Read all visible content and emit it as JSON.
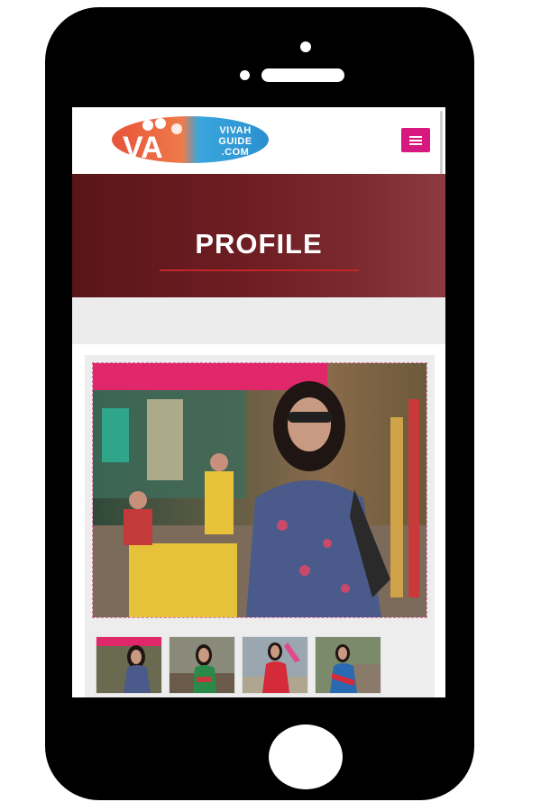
{
  "brand": {
    "line1": "VIVAH",
    "line2": "GUIDE",
    "line3": ".COM",
    "logo_letters": "VA",
    "colors": {
      "orange": "#e8543a",
      "blue": "#2aa8e0",
      "pink": "#d6187f"
    }
  },
  "header": {
    "menu_icon": "hamburger-icon"
  },
  "banner": {
    "title": "PROFILE",
    "accent_line_color": "#c0262a"
  },
  "gallery": {
    "main_photo": "woman-in-sunglasses-floral-dress-photo",
    "thumbnails": [
      "thumbnail-woman-floral-dress",
      "thumbnail-woman-green-top",
      "thumbnail-woman-red-dress-dupatta",
      "thumbnail-woman-blue-saree"
    ]
  }
}
